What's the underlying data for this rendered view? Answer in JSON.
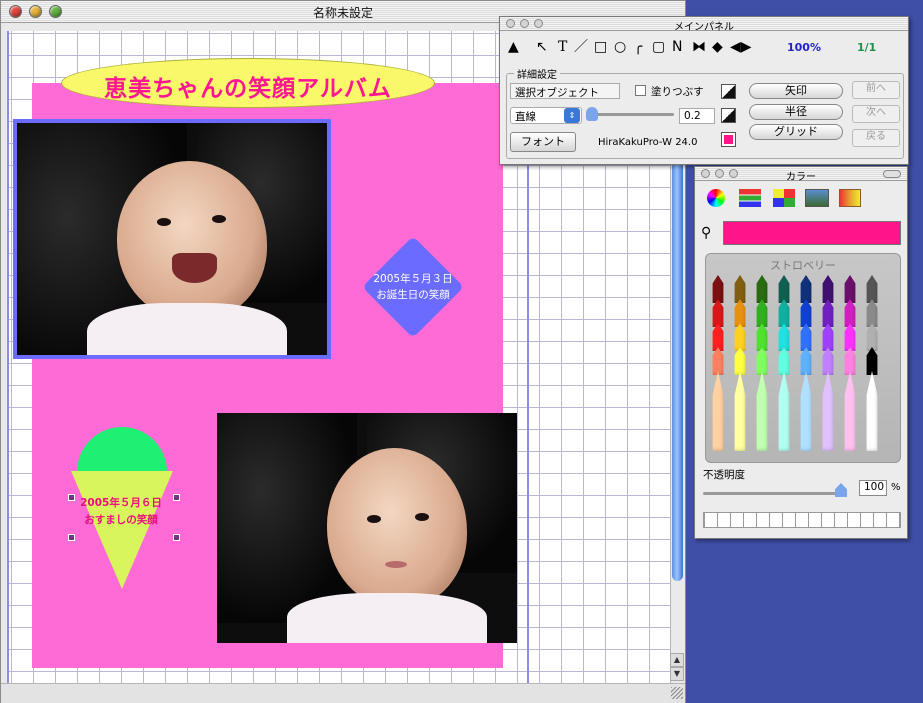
{
  "doc_window": {
    "title": "名称未設定",
    "album": {
      "title": "恵美ちゃんの笑顔アルバム",
      "diamond_caption": [
        "2005年５月３日",
        "お誕生日の笑顔"
      ],
      "icecream_caption": [
        "2005年５月６日",
        "おすましの笑顔"
      ]
    }
  },
  "main_panel": {
    "title": "メインパネル",
    "tools": [
      "▲",
      "↖",
      "T",
      "／",
      "□",
      "○",
      "╭",
      "▢",
      "Ν",
      "⧓",
      "◆",
      "◀▶"
    ],
    "zoom": "100%",
    "page": "1/1",
    "detail_label": "詳細設定",
    "select_object": "選択オブジェクト",
    "fill_label": "塗りつぶす",
    "line_type": "直線",
    "line_width": "0.2",
    "font_button": "フォント",
    "font_name": "HiraKakuPro-W  24.0",
    "arrow_button": "矢印",
    "radius_button": "半径",
    "grid_button": "グリッド",
    "prev_button": "前へ",
    "next_button": "次へ",
    "back_button": "戻る",
    "colors": {
      "fill_color": "#ff1489"
    }
  },
  "color_panel": {
    "title": "カラー",
    "current_color": "#ff1489",
    "crayon_name": "ストロベリー",
    "opacity_label": "不透明度",
    "opacity_value": "100",
    "opacity_unit": "%"
  }
}
